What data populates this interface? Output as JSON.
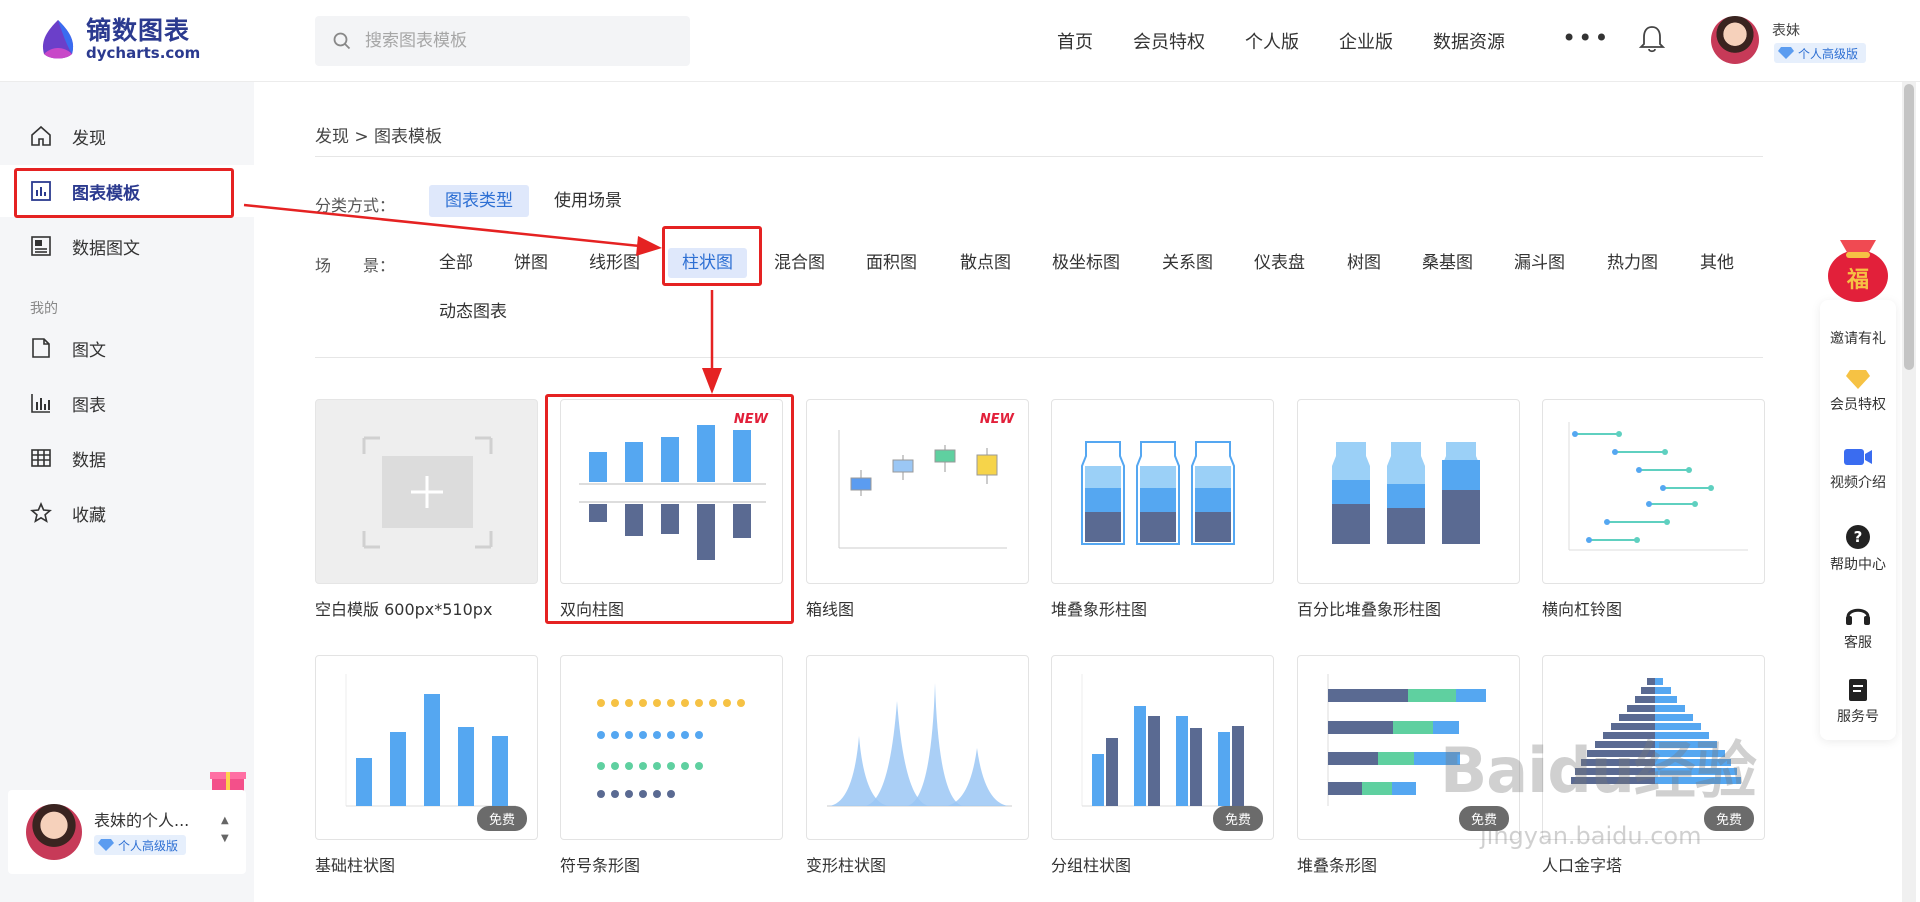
{
  "brand": {
    "name_cn": "镝数图表",
    "name_en": "dycharts.com"
  },
  "search": {
    "placeholder": "搜索图表模板"
  },
  "nav": [
    "首页",
    "会员特权",
    "个人版",
    "企业版",
    "数据资源"
  ],
  "user": {
    "name": "表妹",
    "vip": "个人高级版"
  },
  "sidebar": {
    "items": [
      {
        "label": "发现",
        "icon": "home-icon"
      },
      {
        "label": "图表模板",
        "icon": "bar-chart-icon",
        "active": true
      },
      {
        "label": "数据图文",
        "icon": "document-chart-icon"
      }
    ],
    "section": "我的",
    "my_items": [
      {
        "label": "图文",
        "icon": "file-icon"
      },
      {
        "label": "图表",
        "icon": "chart-icon"
      },
      {
        "label": "数据",
        "icon": "table-icon"
      },
      {
        "label": "收藏",
        "icon": "star-icon"
      }
    ],
    "user_card": {
      "name": "表妹的个人...",
      "vip": "个人高级版"
    }
  },
  "breadcrumb": "发现 > 图表模板",
  "filter": {
    "label": "分类方式：",
    "options": [
      {
        "label": "图表类型",
        "active": true
      },
      {
        "label": "使用场景",
        "active": false
      }
    ]
  },
  "scene": {
    "label": "场　　景：",
    "items": [
      "全部",
      "饼图",
      "线形图",
      "柱状图",
      "混合图",
      "面积图",
      "散点图",
      "极坐标图",
      "关系图",
      "仪表盘",
      "树图",
      "桑基图",
      "漏斗图",
      "热力图",
      "其他",
      "动态图表"
    ],
    "active": "柱状图"
  },
  "cards": [
    {
      "title": "空白模版 600px*510px",
      "tag": ""
    },
    {
      "title": "双向柱图",
      "tag": "NEW"
    },
    {
      "title": "箱线图",
      "tag": "NEW"
    },
    {
      "title": "堆叠象形柱图",
      "tag": ""
    },
    {
      "title": "百分比堆叠象形柱图",
      "tag": ""
    },
    {
      "title": "横向杠铃图",
      "tag": ""
    },
    {
      "title": "基础柱状图",
      "tag": "免费"
    },
    {
      "title": "符号条形图",
      "tag": ""
    },
    {
      "title": "变形柱状图",
      "tag": ""
    },
    {
      "title": "分组柱状图",
      "tag": "免费"
    },
    {
      "title": "堆叠条形图",
      "tag": "免费"
    },
    {
      "title": "人口金字塔",
      "tag": "免费"
    }
  ],
  "float_bar": [
    "邀请有礼",
    "会员特权",
    "视频介绍",
    "帮助中心",
    "客服",
    "服务号"
  ],
  "float_bag_text": "福",
  "watermark": {
    "main": "Baidu经验",
    "sub": "jingyan.baidu.com"
  },
  "colors": {
    "brand": "#2b3a8f",
    "accent": "#2d6fd3",
    "bar": "#55a7f1",
    "dark_bar": "#5a6a92",
    "highlight": "#e52222"
  }
}
